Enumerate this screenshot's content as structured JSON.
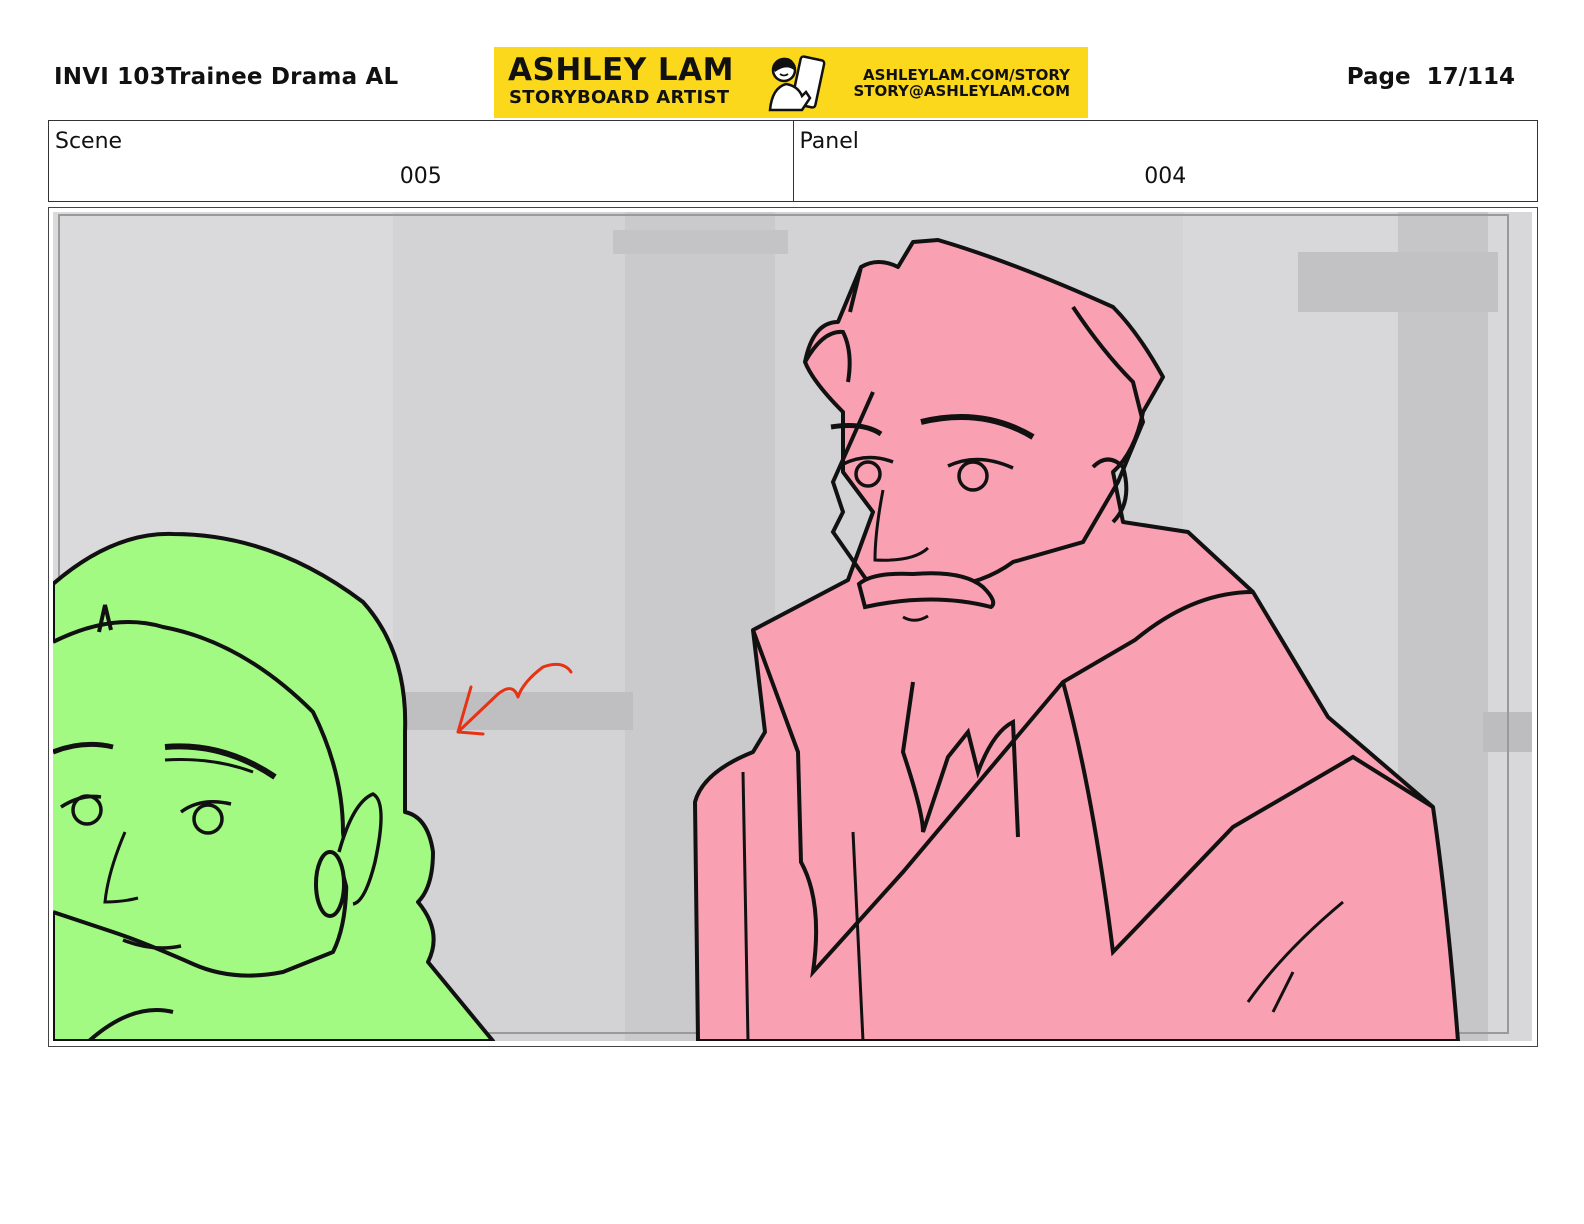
{
  "header": {
    "title": "INVI 103Trainee Drama AL",
    "page_label": "Page",
    "page_number": "17/114"
  },
  "banner": {
    "name": "ASHLEY LAM",
    "role": "STORYBOARD ARTIST",
    "url": "ASHLEYLAM.COM/STORY",
    "email": "STORY@ASHLEYLAM.COM",
    "color": "#fcd81c"
  },
  "meta": {
    "scene_label": "Scene",
    "scene_value": "005",
    "panel_label": "Panel",
    "panel_value": "004"
  },
  "panel": {
    "colors": {
      "background": "#d3d3d6",
      "woman_fill": "#a3fa83",
      "man_fill": "#f9a0b2",
      "arrow": "#e83214",
      "line": "#111111"
    }
  }
}
